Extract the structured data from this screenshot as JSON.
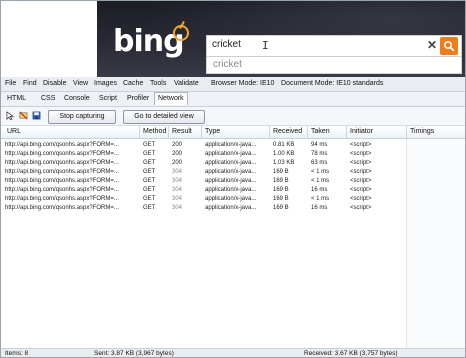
{
  "search": {
    "query": "cricket",
    "suggestion": "cricket",
    "clear_symbol": "✕"
  },
  "devtools": {
    "menu": [
      "File",
      "Find",
      "Disable",
      "View",
      "Images",
      "Cache",
      "Tools",
      "Validate"
    ],
    "browser_mode": "Browser Mode: IE10",
    "document_mode": "Document Mode: IE10 standards",
    "tabs": [
      "HTML",
      "CSS",
      "Console",
      "Script",
      "Profiler",
      "Network"
    ],
    "active_tab": "Network",
    "stop_capturing": "Stop capturing",
    "detailed_view": "Go to detailed view",
    "columns": [
      "URL",
      "Method",
      "Result",
      "Type",
      "Received",
      "Taken",
      "Initiator",
      "Timings"
    ],
    "rows": [
      {
        "url": "http://api.bing.com/qsonhs.aspx?FORM=...",
        "method": "GET",
        "result": "200",
        "type": "application/x-java...",
        "received": "0.81 KB",
        "taken": "94 ms",
        "initiator": "<script>"
      },
      {
        "url": "http://api.bing.com/qsonhs.aspx?FORM=...",
        "method": "GET",
        "result": "200",
        "type": "application/x-java...",
        "received": "1.00 KB",
        "taken": "78 ms",
        "initiator": "<script>"
      },
      {
        "url": "http://api.bing.com/qsonhs.aspx?FORM=...",
        "method": "GET",
        "result": "200",
        "type": "application/x-java...",
        "received": "1.03 KB",
        "taken": "63 ms",
        "initiator": "<script>"
      },
      {
        "url": "http://api.bing.com/qsonhs.aspx?FORM=...",
        "method": "GET",
        "result": "304",
        "type": "application/x-java...",
        "received": "169 B",
        "taken": "< 1 ms",
        "initiator": "<script>"
      },
      {
        "url": "http://api.bing.com/qsonhs.aspx?FORM=...",
        "method": "GET",
        "result": "304",
        "type": "application/x-java...",
        "received": "169 B",
        "taken": "< 1 ms",
        "initiator": "<script>"
      },
      {
        "url": "http://api.bing.com/qsonhs.aspx?FORM=...",
        "method": "GET",
        "result": "304",
        "type": "application/x-java...",
        "received": "169 B",
        "taken": "16 ms",
        "initiator": "<script>"
      },
      {
        "url": "http://api.bing.com/qsonhs.aspx?FORM=...",
        "method": "GET",
        "result": "304",
        "type": "application/x-java...",
        "received": "169 B",
        "taken": "< 1 ms",
        "initiator": "<script>"
      },
      {
        "url": "http://api.bing.com/qsonhs.aspx?FORM=...",
        "method": "GET",
        "result": "304",
        "type": "application/x-java...",
        "received": "169 B",
        "taken": "16 ms",
        "initiator": "<script>"
      }
    ],
    "status": {
      "items": "Items: 8",
      "sent": "Sent: 3.87 KB (3,967 bytes)",
      "received": "Received: 3.67 KB (3,757 bytes)"
    }
  }
}
